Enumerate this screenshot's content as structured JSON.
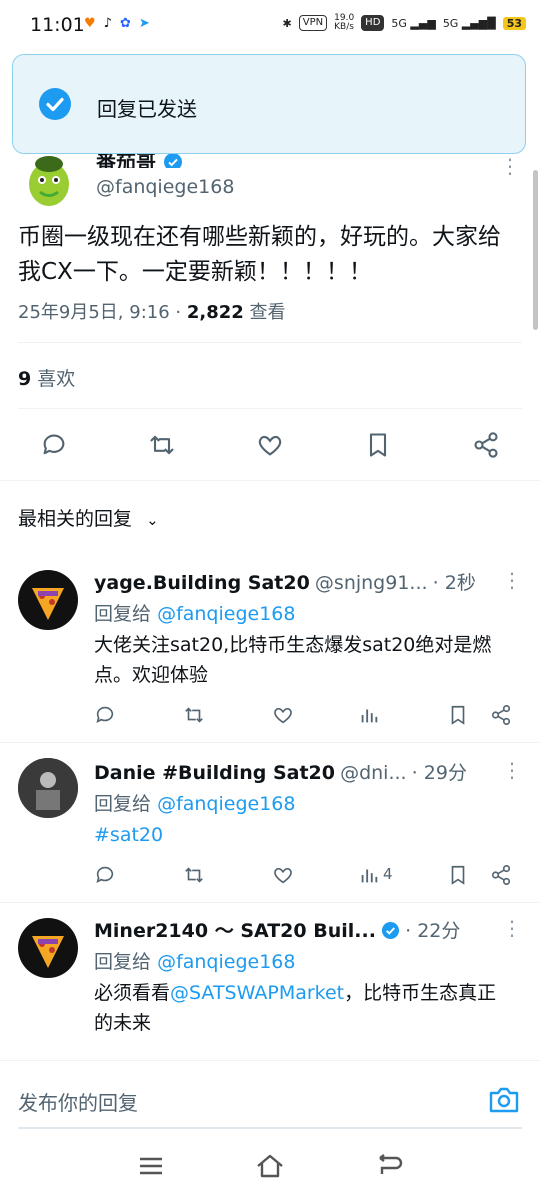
{
  "status_bar": {
    "time": "11:01",
    "vpn": "VPN",
    "speed": "19.0",
    "speed_unit": "KB/s",
    "hd": "HD",
    "net1": "5G",
    "net2": "5G",
    "battery": "53"
  },
  "toast": {
    "message": "回复已发送"
  },
  "tweet": {
    "author_name": "番茄哥",
    "author_handle": "@fanqiege168",
    "text": "币圈一级现在还有哪些新颖的，好玩的。大家给我CX一下。一定要新颖！！！！！",
    "datetime": "25年9月5日, 9:16",
    "views_count": "2,822",
    "views_label": "查看",
    "likes_count": "9",
    "likes_label": "喜欢"
  },
  "sort_label": "最相关的回复",
  "replies": [
    {
      "name": "yage.Building Sat20",
      "handle": "@snjng91...",
      "time": "2秒",
      "reply_to_label": "回复给",
      "reply_to": "@fanqiege168",
      "body": "大佬关注sat20,比特币生态爆发sat20绝对是燃点。欢迎体验",
      "views": ""
    },
    {
      "name": "Danie #Building Sat20",
      "handle": "@dni...",
      "time": "29分",
      "reply_to_label": "回复给",
      "reply_to": "@fanqiege168",
      "body": "#sat20",
      "views": "4"
    },
    {
      "name": "Miner2140 ～ SAT20 Buil...",
      "handle": "",
      "time": "22分",
      "reply_to_label": "回复给",
      "reply_to": "@fanqiege168",
      "body_pre": "必须看看",
      "body_mention": "@SATSWAPMarket",
      "body_post": "，比特币生态真正的未来",
      "views": ""
    }
  ],
  "composer": {
    "placeholder": "发布你的回复"
  },
  "colors": {
    "accent": "#1d9bf0",
    "text": "#0f1419",
    "muted": "#536471"
  }
}
